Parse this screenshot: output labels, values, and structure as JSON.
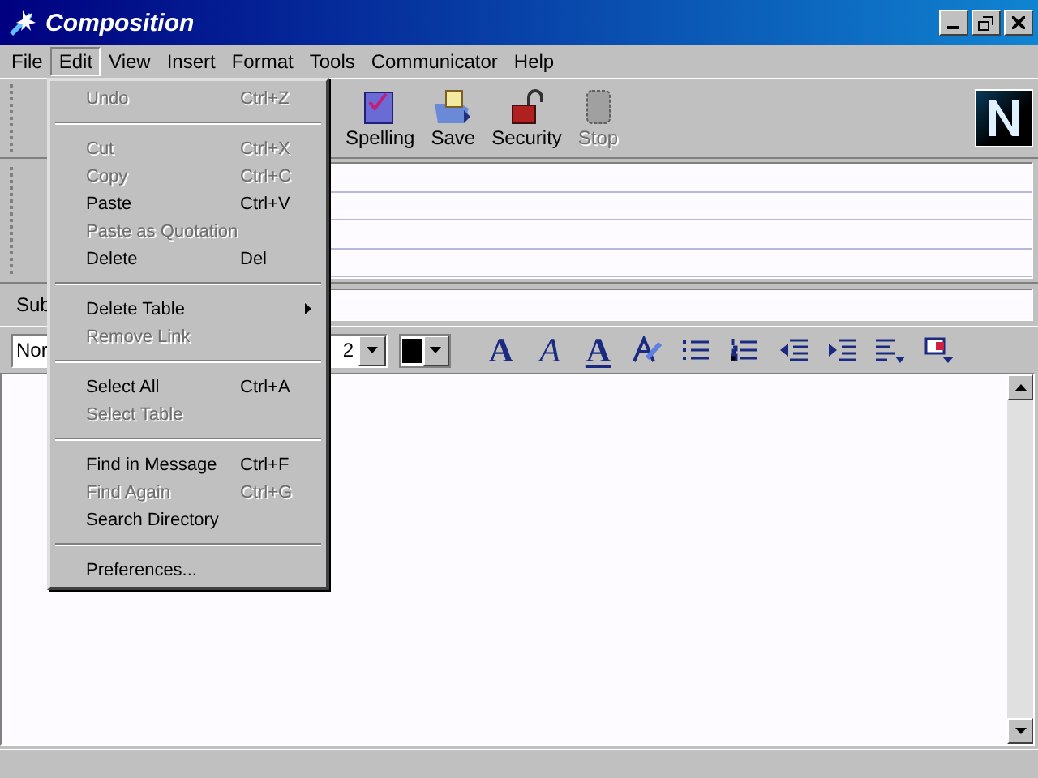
{
  "window": {
    "title": "Composition"
  },
  "menubar": [
    {
      "label": "File",
      "selected": false
    },
    {
      "label": "Edit",
      "selected": true
    },
    {
      "label": "View",
      "selected": false
    },
    {
      "label": "Insert",
      "selected": false
    },
    {
      "label": "Format",
      "selected": false
    },
    {
      "label": "Tools",
      "selected": false
    },
    {
      "label": "Communicator",
      "selected": false
    },
    {
      "label": "Help",
      "selected": false
    }
  ],
  "toolbar": [
    {
      "label": "Spelling",
      "kind": "spelling",
      "disabled": false
    },
    {
      "label": "Save",
      "kind": "save",
      "disabled": false
    },
    {
      "label": "Security",
      "kind": "security",
      "disabled": false
    },
    {
      "label": "Stop",
      "kind": "stop",
      "disabled": true
    }
  ],
  "subject": {
    "label": "Sub"
  },
  "format_bar": {
    "style": "Nor",
    "size": "2",
    "buttons": [
      {
        "kind": "bold",
        "glyph": "A"
      },
      {
        "kind": "italic",
        "glyph": "A"
      },
      {
        "kind": "underline",
        "glyph": "A"
      },
      {
        "kind": "clear"
      },
      {
        "kind": "bullets"
      },
      {
        "kind": "numbers"
      },
      {
        "kind": "outdent"
      },
      {
        "kind": "indent"
      },
      {
        "kind": "align"
      },
      {
        "kind": "insert"
      }
    ]
  },
  "edit_menu": [
    {
      "kind": "item",
      "label": "Undo",
      "shortcut": "Ctrl+Z",
      "disabled": true
    },
    {
      "kind": "separator"
    },
    {
      "kind": "item",
      "label": "Cut",
      "shortcut": "Ctrl+X",
      "disabled": true
    },
    {
      "kind": "item",
      "label": "Copy",
      "shortcut": "Ctrl+C",
      "disabled": true
    },
    {
      "kind": "item",
      "label": "Paste",
      "shortcut": "Ctrl+V",
      "disabled": false
    },
    {
      "kind": "item",
      "label": "Paste as Quotation",
      "disabled": true
    },
    {
      "kind": "item",
      "label": "Delete",
      "shortcut": "Del",
      "disabled": false
    },
    {
      "kind": "separator"
    },
    {
      "kind": "submenu",
      "label": "Delete Table",
      "disabled": false
    },
    {
      "kind": "item",
      "label": "Remove Link",
      "disabled": true
    },
    {
      "kind": "separator"
    },
    {
      "kind": "item",
      "label": "Select All",
      "shortcut": "Ctrl+A",
      "disabled": false
    },
    {
      "kind": "item",
      "label": "Select Table",
      "disabled": true
    },
    {
      "kind": "separator"
    },
    {
      "kind": "item",
      "label": "Find in Message",
      "shortcut": "Ctrl+F",
      "disabled": false
    },
    {
      "kind": "item",
      "label": "Find Again",
      "shortcut": "Ctrl+G",
      "disabled": true
    },
    {
      "kind": "item",
      "label": "Search Directory",
      "disabled": false
    },
    {
      "kind": "separator"
    },
    {
      "kind": "item",
      "label": "Preferences...",
      "disabled": false
    }
  ]
}
